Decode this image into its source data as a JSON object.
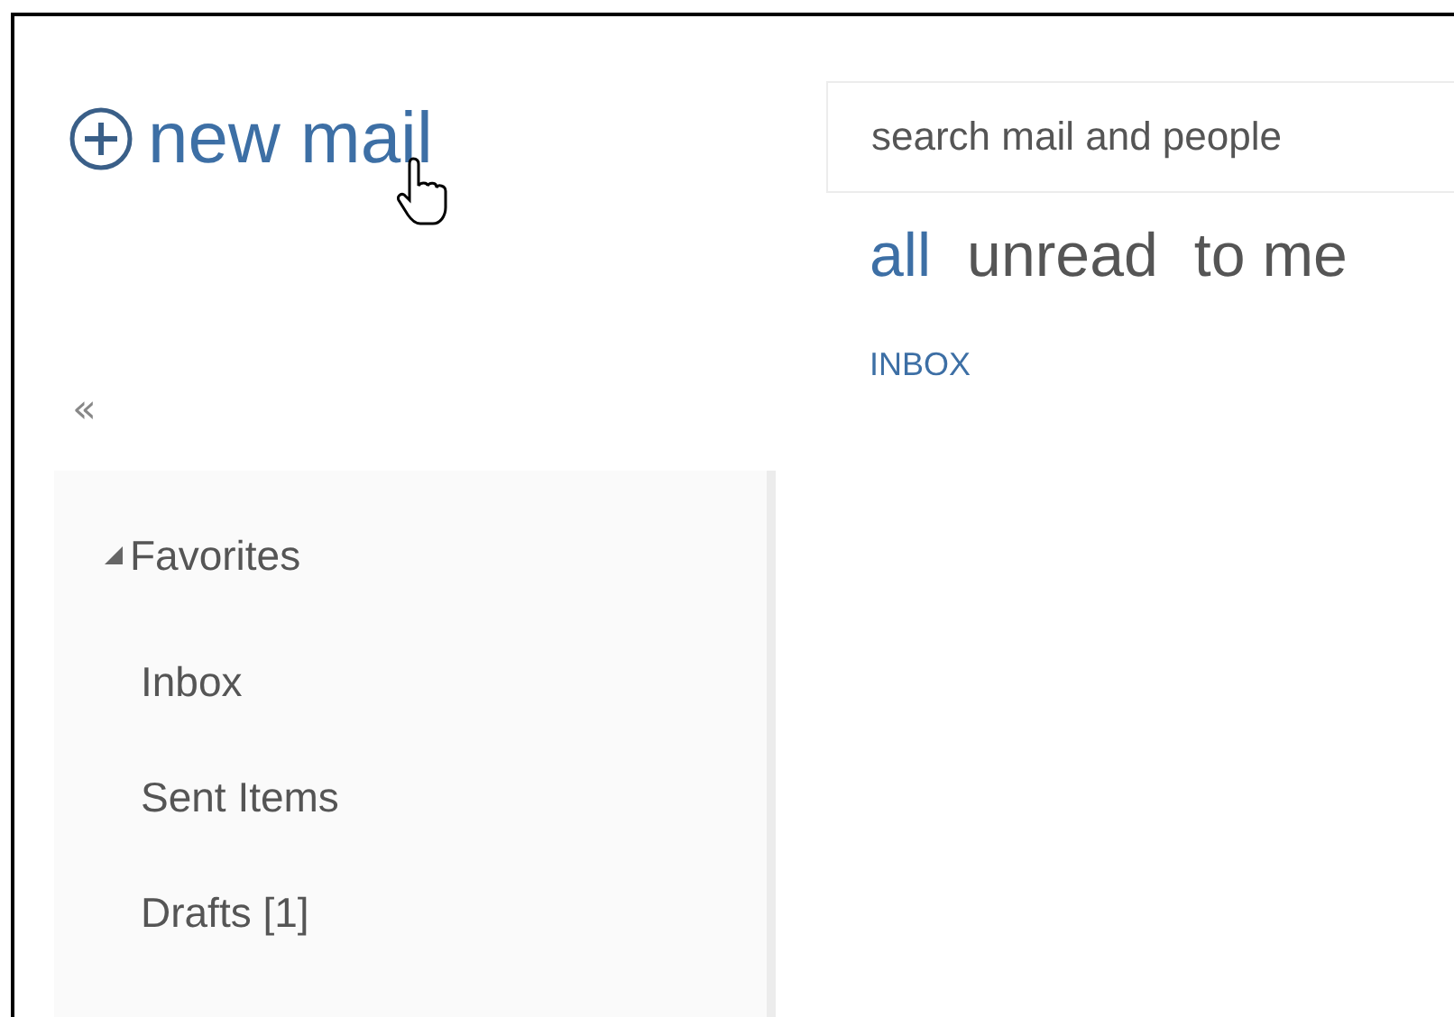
{
  "new_mail": {
    "label": "new mail"
  },
  "collapse": {
    "label": "«"
  },
  "search": {
    "placeholder": "search mail and people"
  },
  "filters": [
    {
      "label": "all",
      "selected": true
    },
    {
      "label": "unread",
      "selected": false
    },
    {
      "label": "to me",
      "selected": false
    }
  ],
  "folder_title": "INBOX",
  "favorites": {
    "label": "Favorites",
    "expanded": true,
    "children": [
      {
        "label": "Inbox"
      },
      {
        "label": "Sent Items"
      },
      {
        "label": "Drafts [1]"
      }
    ]
  }
}
